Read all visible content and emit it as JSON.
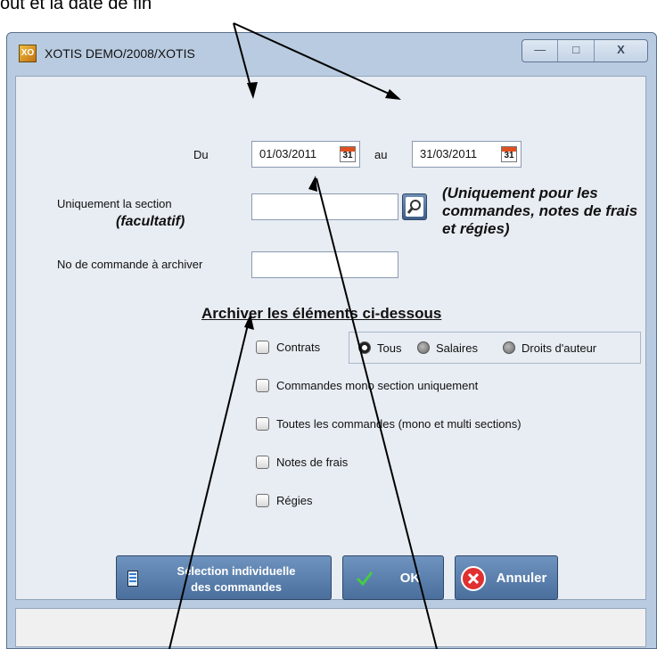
{
  "annotation": {
    "top_text": "out et la date de fin"
  },
  "window": {
    "title": "XOTIS DEMO/2008/XOTIS",
    "icon_text": "XO",
    "controls": {
      "minimize": "—",
      "maximize": "□",
      "close": "X"
    }
  },
  "form": {
    "du_label": "Du",
    "date_from": "01/03/2011",
    "au_label": "au",
    "date_to": "31/03/2011",
    "calendar_day": "31",
    "section_label": "Uniquement la section",
    "section_optional": "(facultatif)",
    "section_value": "",
    "section_note": "(Uniquement pour les commandes, notes de frais et régies)",
    "order_label": "No de commande à archiver",
    "order_value": ""
  },
  "archive": {
    "title": "Archiver les éléments ci-dessous",
    "contrats_label": "Contrats",
    "radio_tous": "Tous",
    "radio_salaires": "Salaires",
    "radio_droits": "Droits d'auteur",
    "commandes_mono": "Commandes mono section uniquement",
    "toutes_commandes": "Toutes les commandes (mono et multi sections)",
    "notes_frais": "Notes de frais",
    "regies": "Régies"
  },
  "buttons": {
    "selection_line1": "Sélection individuelle",
    "selection_line2": "des commandes",
    "ok": "OK",
    "annuler": "Annuler"
  },
  "colors": {
    "window_frame": "#b9cbe0",
    "client_bg": "#e8edf3",
    "button_blue": "#5b80ae",
    "cancel_red": "#e03030"
  }
}
